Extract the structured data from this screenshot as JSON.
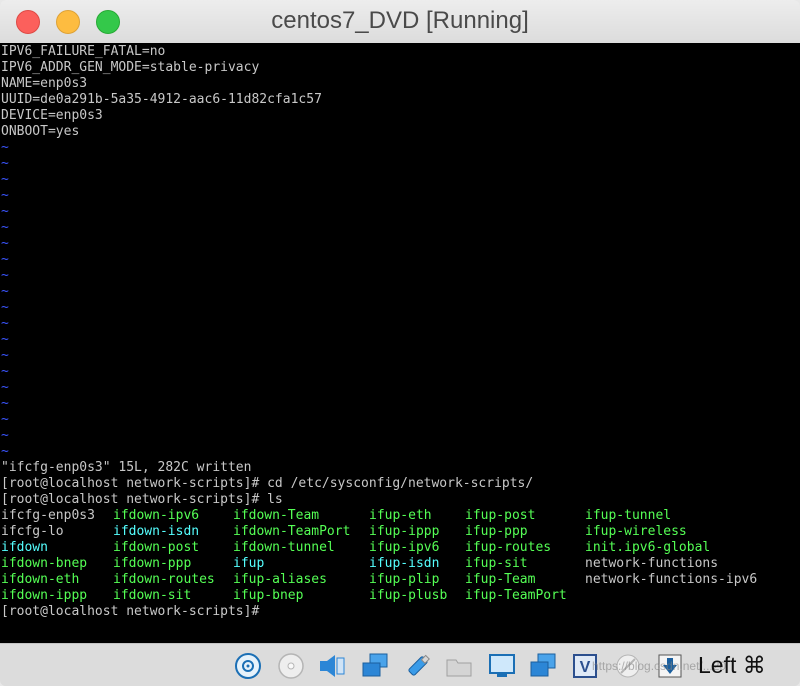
{
  "window": {
    "title": "centos7_DVD [Running]"
  },
  "terminal": {
    "file_lines": [
      "IPV6_FAILURE_FATAL=no",
      "IPV6_ADDR_GEN_MODE=stable-privacy",
      "NAME=enp0s3",
      "UUID=de0a291b-5a35-4912-aac6-11d82cfa1c57",
      "DEVICE=enp0s3",
      "ONBOOT=yes"
    ],
    "tilde_char": "~",
    "tilde_count": 20,
    "status_line": "\"ifcfg-enp0s3\" 15L, 282C written",
    "prompt_cd": "[root@localhost network-scripts]# cd /etc/sysconfig/network-scripts/",
    "prompt_ls": "[root@localhost network-scripts]# ls",
    "final_prompt": "[root@localhost network-scripts]#",
    "ls_rows": [
      [
        "ifcfg-enp0s3",
        "ifdown-ipv6",
        "ifdown-Team",
        "ifup-eth",
        "ifup-post",
        "ifup-tunnel"
      ],
      [
        "ifcfg-lo",
        "ifdown-isdn",
        "ifdown-TeamPort",
        "ifup-ippp",
        "ifup-ppp",
        "ifup-wireless"
      ],
      [
        "ifdown",
        "ifdown-post",
        "ifdown-tunnel",
        "ifup-ipv6",
        "ifup-routes",
        "init.ipv6-global"
      ],
      [
        "ifdown-bnep",
        "ifdown-ppp",
        "ifup",
        "ifup-isdn",
        "ifup-sit",
        "network-functions"
      ],
      [
        "ifdown-eth",
        "ifdown-routes",
        "ifup-aliases",
        "ifup-plip",
        "ifup-Team",
        "network-functions-ipv6"
      ],
      [
        "ifdown-ippp",
        "ifdown-sit",
        "ifup-bnep",
        "ifup-plusb",
        "ifup-TeamPort",
        ""
      ]
    ],
    "ls_colors": [
      [
        "plain",
        "exec",
        "exec",
        "exec",
        "exec",
        "exec"
      ],
      [
        "plain",
        "link",
        "exec",
        "exec",
        "exec",
        "exec"
      ],
      [
        "link",
        "exec",
        "exec",
        "exec",
        "exec",
        "exec"
      ],
      [
        "exec",
        "exec",
        "link",
        "link",
        "exec",
        "plain"
      ],
      [
        "exec",
        "exec",
        "exec",
        "exec",
        "exec",
        "plain"
      ],
      [
        "exec",
        "exec",
        "exec",
        "exec",
        "exec",
        "plain"
      ]
    ]
  },
  "colors": {
    "plain": "#c8c8c8",
    "exec": "#55ff55",
    "link": "#55ffff",
    "tilde": "#3a55ff"
  },
  "statusbar": {
    "icons": [
      "hard-disk-icon",
      "optical-drive-icon",
      "audio-icon",
      "network-icon",
      "usb-icon",
      "shared-folder-icon",
      "display-icon",
      "video-capture-icon",
      "virtualbox-icon",
      "recording-icon",
      "mouse-integration-icon"
    ],
    "host_key": "Left ⌘",
    "watermark": "https://blog.csdn.net/...20"
  }
}
